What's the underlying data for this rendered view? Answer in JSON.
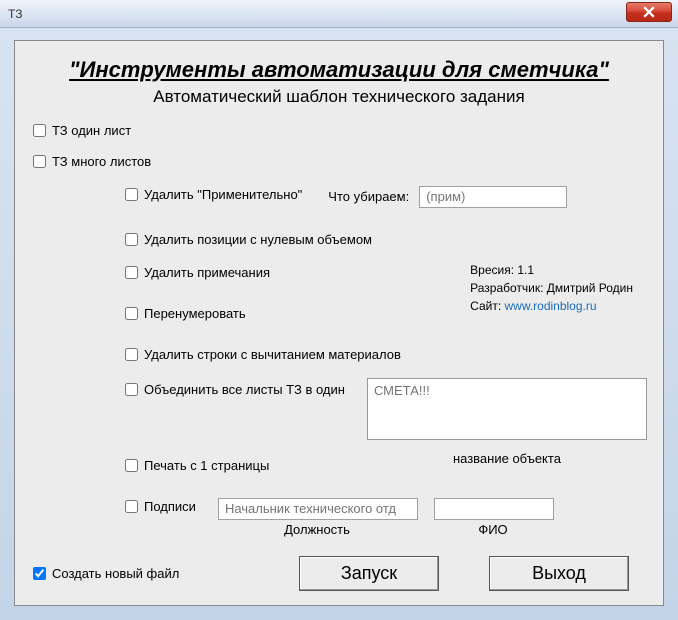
{
  "window": {
    "title": "ТЗ"
  },
  "header": {
    "title": "\"Инструменты автоматизации для сметчика\"",
    "subtitle": "Автоматический шаблон технического задания"
  },
  "checks": {
    "one_sheet": "ТЗ один лист",
    "many_sheets": "ТЗ много листов",
    "del_approx": "Удалить \"Применительно\"",
    "del_zero": "Удалить позиции с нулевым объемом",
    "del_notes": "Удалить примечания",
    "renumber": "Перенумеровать",
    "del_minus_mat": "Удалить строки с  вычитанием материалов",
    "merge_sheets": "Объединить все листы ТЗ в один",
    "print_from1": "Печать с 1 страницы",
    "signatures": "Подписи",
    "create_new": "Создать новый  файл"
  },
  "labels": {
    "what_remove": "Что убираем:",
    "object_name": "название объекта",
    "position": "Должность",
    "fio": "ФИО"
  },
  "placeholders": {
    "remove_input": "(прим)",
    "object_textarea": "СМЕТА!!!",
    "position_input": "Начальник технического отд"
  },
  "info": {
    "version_label": "Вресия: 1.1",
    "dev_label": "Разработчик: Дмитрий Родин",
    "site_label": "Сайт: ",
    "site_url": "www.rodinblog.ru"
  },
  "buttons": {
    "run": "Запуск",
    "exit": "Выход"
  }
}
